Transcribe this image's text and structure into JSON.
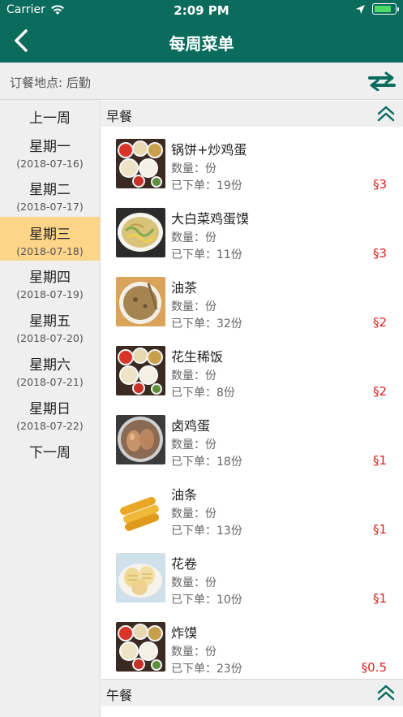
{
  "status_bar": {
    "carrier": "Carrier",
    "time": "2:09 PM",
    "battery_level": 0.85
  },
  "nav": {
    "title": "每周菜单",
    "back_icon": "chevron-left-icon"
  },
  "location": {
    "label": "订餐地点: 后勤",
    "swap_icon": "swap-arrows-icon"
  },
  "sidebar": {
    "prev_week": "上一周",
    "next_week": "下一周",
    "days": [
      {
        "day": "星期一",
        "date": "(2018-07-16)"
      },
      {
        "day": "星期二",
        "date": "(2018-07-17)"
      },
      {
        "day": "星期三",
        "date": "(2018-07-18)"
      },
      {
        "day": "星期四",
        "date": "(2018-07-19)"
      },
      {
        "day": "星期五",
        "date": "(2018-07-20)"
      },
      {
        "day": "星期六",
        "date": "(2018-07-21)"
      },
      {
        "day": "星期日",
        "date": "(2018-07-22)"
      }
    ],
    "selected_index": 2
  },
  "sections": [
    {
      "name": "早餐",
      "dishes": [
        {
          "name": "锅饼+炒鸡蛋",
          "qty": "数量：份",
          "ordered": "已下单：19份",
          "price": "§3",
          "photo": "spread"
        },
        {
          "name": "大白菜鸡蛋馍",
          "qty": "数量：份",
          "ordered": "已下单：11份",
          "price": "§3",
          "photo": "cabbage"
        },
        {
          "name": "油茶",
          "qty": "数量：份",
          "ordered": "已下单：32份",
          "price": "§2",
          "photo": "soup"
        },
        {
          "name": "花生稀饭",
          "qty": "数量：份",
          "ordered": "已下单：8份",
          "price": "§2",
          "photo": "spread"
        },
        {
          "name": "卤鸡蛋",
          "qty": "数量：份",
          "ordered": "已下单：18份",
          "price": "§1",
          "photo": "egg"
        },
        {
          "name": "油条",
          "qty": "数量：份",
          "ordered": "已下单：13份",
          "price": "§1",
          "photo": "youtiao"
        },
        {
          "name": "花卷",
          "qty": "数量：份",
          "ordered": "已下单：10份",
          "price": "§1",
          "photo": "roll"
        },
        {
          "name": "炸馍",
          "qty": "数量：份",
          "ordered": "已下单：23份",
          "price": "§0.5",
          "photo": "spread"
        }
      ]
    },
    {
      "name": "午餐",
      "dishes": []
    }
  ],
  "colors": {
    "brand": "#0b6b5c",
    "selected_day": "#fcd588",
    "price": "#e02020"
  }
}
